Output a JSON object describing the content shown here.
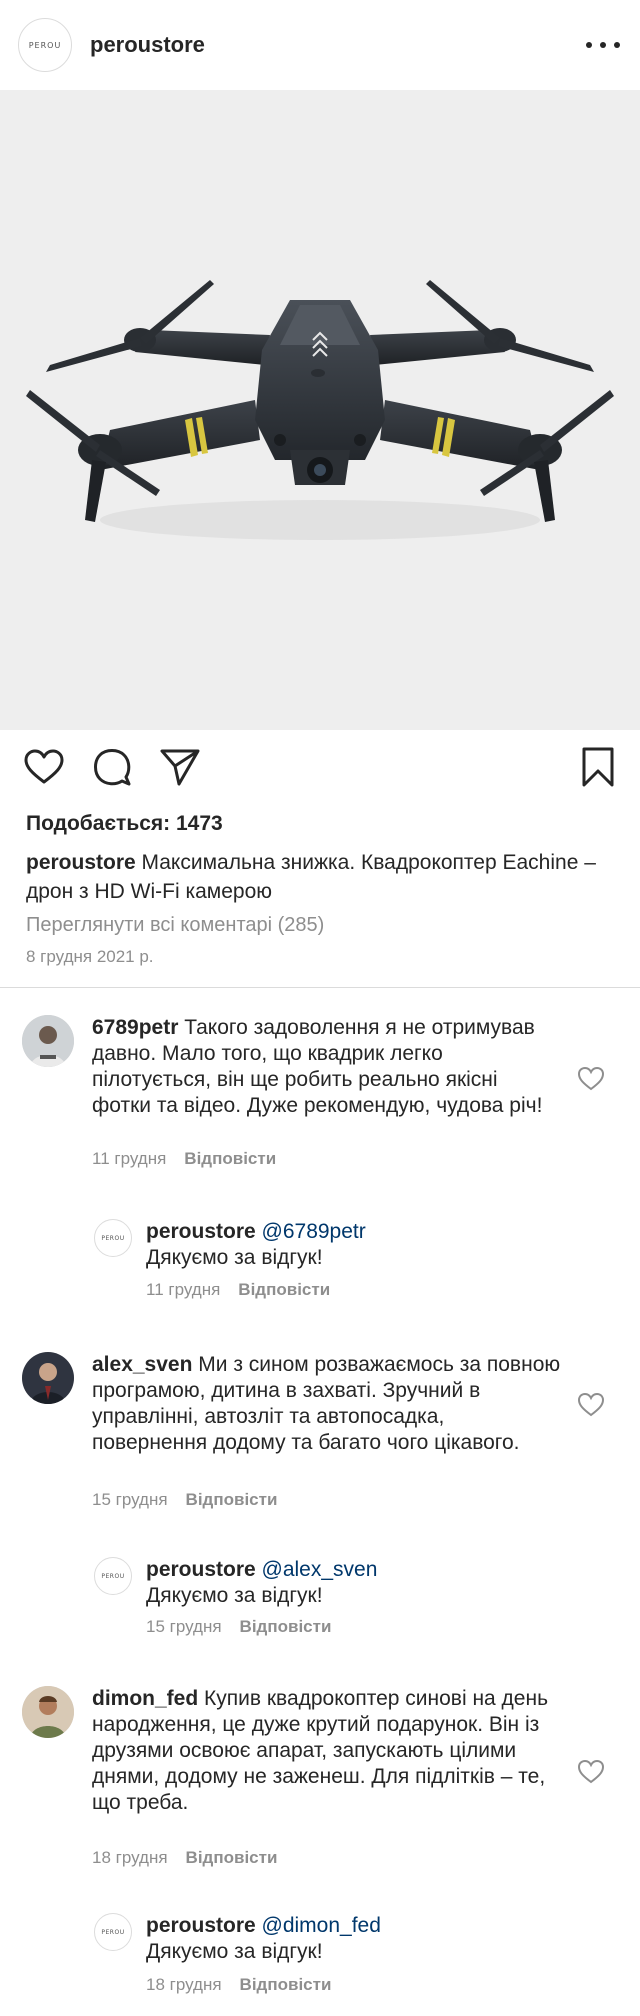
{
  "header": {
    "avatar_text": "PEROU",
    "username": "peroustore"
  },
  "post": {
    "image_alt": "drone-photo",
    "likes_label": "Подобається: 1473",
    "caption_user": "peroustore",
    "caption_text": " Максимальна знижка. Квадрокоптер Eachine – дрон з HD Wi-Fi камерою",
    "view_all_comments": "Переглянути всі коментарі (285)",
    "date": "8 грудня 2021 р."
  },
  "icons": {
    "like": "heart-icon",
    "comment": "comment-bubble-icon",
    "share": "paper-plane-icon",
    "save": "bookmark-icon",
    "more": "more-dots-icon"
  },
  "comments": [
    {
      "user": "6789petr",
      "text": " Такого задоволення я не отримував давно. Мало того, що квадрик легко пілотується, він ще робить реально якісні фотки та відео. Дуже рекомендую, чудова річ!",
      "date": "11 грудня",
      "reply_label": "Відповісти",
      "reply": {
        "user": "peroustore",
        "mention": " @6789petr",
        "text": "Дякуємо за відгук!",
        "date": "11 грудня",
        "reply_label": "Відповісти",
        "avatar_text": "PEROU"
      }
    },
    {
      "user": "alex_sven",
      "text": " Ми з сином розважаємось за повною програмою, дитина в захваті. Зручний в управлінні, автозліт та автопосадка, повернення додому та багато чого цікавого.",
      "date": "15 грудня",
      "reply_label": "Відповісти",
      "reply": {
        "user": "peroustore",
        "mention": " @alex_sven",
        "text": "Дякуємо за відгук!",
        "date": "15 грудня",
        "reply_label": "Відповісти",
        "avatar_text": "PEROU"
      }
    },
    {
      "user": "dimon_fed",
      "text": " Купив квадрокоптер синові на день народження, це дуже крутий подарунок. Він із друзями освоює апарат, запускають цілими днями, додому не заженеш. Для підлітків – те, що треба.",
      "date": "18 грудня",
      "reply_label": "Відповісти",
      "reply": {
        "user": "peroustore",
        "mention": " @dimon_fed",
        "text": "Дякуємо за відгук!",
        "date": "18 грудня",
        "reply_label": "Відповісти",
        "avatar_text": "PEROU"
      }
    }
  ]
}
